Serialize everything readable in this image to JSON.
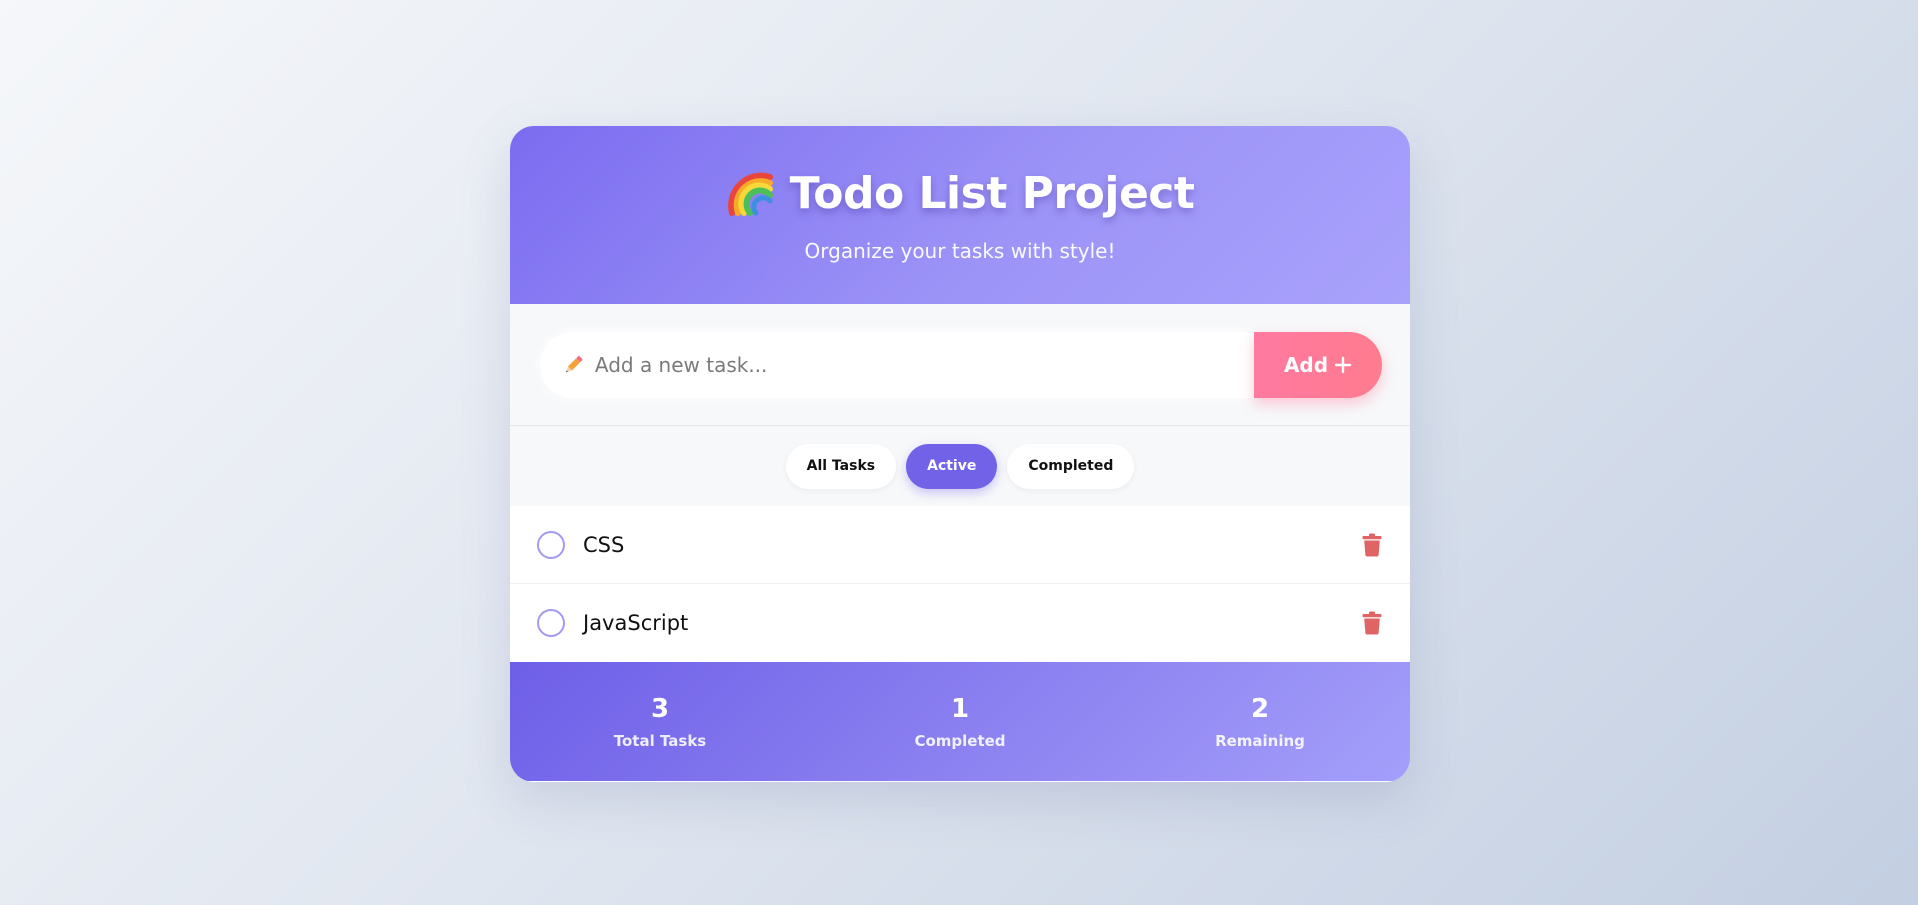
{
  "header": {
    "title": "Todo List Project",
    "subtitle": "Organize your tasks with style!",
    "icon": "rainbow-icon"
  },
  "input": {
    "placeholder": "Add a new task...",
    "value": "",
    "icon": "pencil-icon",
    "add_label": "Add"
  },
  "filters": [
    {
      "label": "All Tasks",
      "active": false
    },
    {
      "label": "Active",
      "active": true
    },
    {
      "label": "Completed",
      "active": false
    }
  ],
  "tasks": [
    {
      "text": "CSS",
      "completed": false
    },
    {
      "text": "JavaScript",
      "completed": false
    }
  ],
  "stats": [
    {
      "value": "3",
      "label": "Total Tasks"
    },
    {
      "value": "1",
      "label": "Completed"
    },
    {
      "value": "2",
      "label": "Remaining"
    }
  ],
  "colors": {
    "accent": "#7262e8",
    "add_button": "#ff7a98",
    "delete": "#e06464"
  }
}
